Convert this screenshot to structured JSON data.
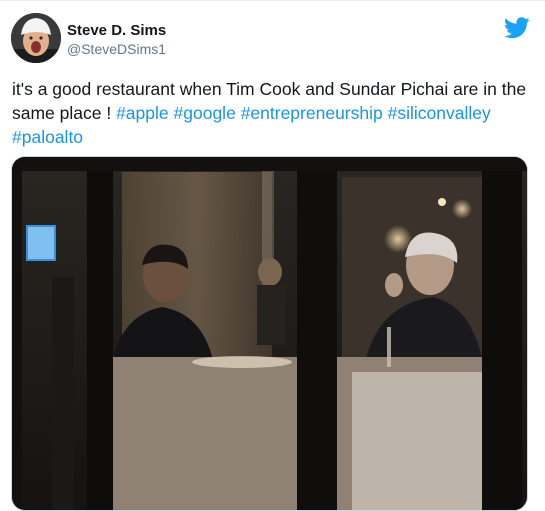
{
  "tweet": {
    "author": {
      "display_name": "Steve D. Sims",
      "handle": "@SteveDSims1"
    },
    "text_parts": [
      {
        "type": "text",
        "value": "it's a good restaurant when Tim Cook and Sundar Pichai are in the same place ! "
      },
      {
        "type": "hashtag",
        "value": "#apple"
      },
      {
        "type": "text",
        "value": " "
      },
      {
        "type": "hashtag",
        "value": "#google"
      },
      {
        "type": "text",
        "value": " "
      },
      {
        "type": "hashtag",
        "value": "#entrepreneurship"
      },
      {
        "type": "text",
        "value": " "
      },
      {
        "type": "hashtag",
        "value": "#siliconvalley"
      },
      {
        "type": "text",
        "value": " "
      },
      {
        "type": "hashtag",
        "value": "#paloalto"
      }
    ],
    "brand_icon": "twitter-bird-icon",
    "colors": {
      "brand": "#1da1f2",
      "hashtag": "#1b95e0",
      "text": "#14171a",
      "secondary_text": "#657786"
    }
  }
}
